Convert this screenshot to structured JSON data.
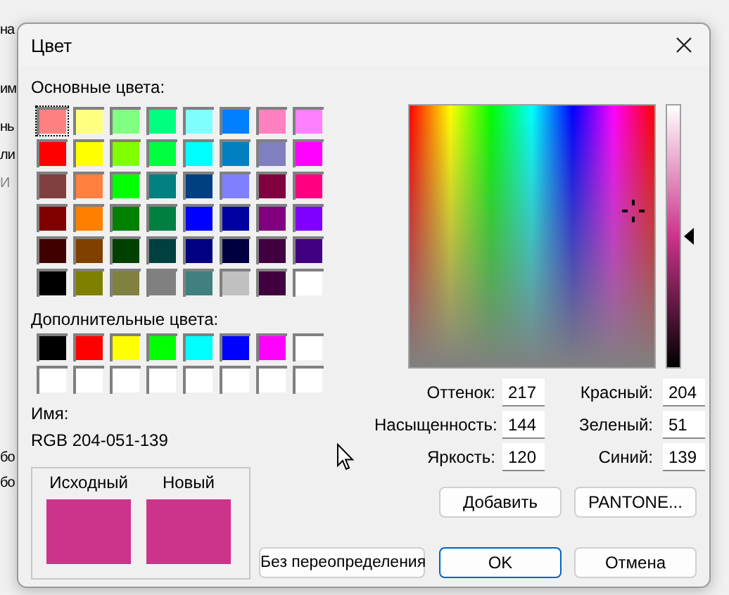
{
  "background_fragments": [
    "на",
    "им",
    "нь",
    "ли",
    "И",
    "бо",
    "бо"
  ],
  "window": {
    "title": "Цвет"
  },
  "basic_colors": {
    "label": "Основные цвета:",
    "swatches": [
      {
        "color": "#ff8080",
        "selected": true
      },
      {
        "color": "#ffff80",
        "selected": false
      },
      {
        "color": "#80ff80",
        "selected": false
      },
      {
        "color": "#00ff80",
        "selected": false
      },
      {
        "color": "#80ffff",
        "selected": false
      },
      {
        "color": "#0080ff",
        "selected": false
      },
      {
        "color": "#ff80c0",
        "selected": false
      },
      {
        "color": "#ff80ff",
        "selected": false
      },
      {
        "color": "#ff0000",
        "selected": false
      },
      {
        "color": "#ffff00",
        "selected": false
      },
      {
        "color": "#80ff00",
        "selected": false
      },
      {
        "color": "#00ff40",
        "selected": false
      },
      {
        "color": "#00ffff",
        "selected": false
      },
      {
        "color": "#0080c0",
        "selected": false
      },
      {
        "color": "#8080c0",
        "selected": false
      },
      {
        "color": "#ff00ff",
        "selected": false
      },
      {
        "color": "#804040",
        "selected": false
      },
      {
        "color": "#ff8040",
        "selected": false
      },
      {
        "color": "#00ff00",
        "selected": false
      },
      {
        "color": "#008080",
        "selected": false
      },
      {
        "color": "#004080",
        "selected": false
      },
      {
        "color": "#8080ff",
        "selected": false
      },
      {
        "color": "#800040",
        "selected": false
      },
      {
        "color": "#ff0080",
        "selected": false
      },
      {
        "color": "#800000",
        "selected": false
      },
      {
        "color": "#ff8000",
        "selected": false
      },
      {
        "color": "#008000",
        "selected": false
      },
      {
        "color": "#008040",
        "selected": false
      },
      {
        "color": "#0000ff",
        "selected": false
      },
      {
        "color": "#0000a0",
        "selected": false
      },
      {
        "color": "#800080",
        "selected": false
      },
      {
        "color": "#8000ff",
        "selected": false
      },
      {
        "color": "#400000",
        "selected": false
      },
      {
        "color": "#804000",
        "selected": false
      },
      {
        "color": "#004000",
        "selected": false
      },
      {
        "color": "#004040",
        "selected": false
      },
      {
        "color": "#000080",
        "selected": false
      },
      {
        "color": "#000040",
        "selected": false
      },
      {
        "color": "#400040",
        "selected": false
      },
      {
        "color": "#400080",
        "selected": false
      },
      {
        "color": "#000000",
        "selected": false
      },
      {
        "color": "#808000",
        "selected": false
      },
      {
        "color": "#808040",
        "selected": false
      },
      {
        "color": "#808080",
        "selected": false
      },
      {
        "color": "#408080",
        "selected": false
      },
      {
        "color": "#c0c0c0",
        "selected": false
      },
      {
        "color": "#400040",
        "selected": false
      },
      {
        "color": "#ffffff",
        "selected": false
      }
    ]
  },
  "custom_colors": {
    "label": "Дополнительные цвета:",
    "swatches": [
      {
        "color": "#000000",
        "selected": false
      },
      {
        "color": "#ff0000",
        "selected": false
      },
      {
        "color": "#ffff00",
        "selected": false
      },
      {
        "color": "#00ff00",
        "selected": false
      },
      {
        "color": "#00ffff",
        "selected": false
      },
      {
        "color": "#0000ff",
        "selected": false
      },
      {
        "color": "#ff00ff",
        "selected": false
      },
      {
        "color": "#ffffff",
        "selected": false
      },
      {
        "color": "#ffffff",
        "selected": false
      },
      {
        "color": "#ffffff",
        "selected": false
      },
      {
        "color": "#ffffff",
        "selected": false
      },
      {
        "color": "#ffffff",
        "selected": false
      },
      {
        "color": "#ffffff",
        "selected": false
      },
      {
        "color": "#ffffff",
        "selected": false
      },
      {
        "color": "#ffffff",
        "selected": false
      },
      {
        "color": "#ffffff",
        "selected": false
      }
    ]
  },
  "name": {
    "label": "Имя:",
    "value": "RGB 204-051-139"
  },
  "preview": [
    {
      "label": "Исходный",
      "color": "#cc338b"
    },
    {
      "label": "Новый",
      "color": "#cc338b"
    }
  ],
  "luminance_slider": {
    "level": 0.5
  },
  "fields": [
    {
      "label": "Оттенок:",
      "value": "217"
    },
    {
      "label": "Красный:",
      "value": "204"
    },
    {
      "label": "Насыщенность:",
      "value": "144"
    },
    {
      "label": "Зеленый:",
      "value": "51"
    },
    {
      "label": "Яркость:",
      "value": "120"
    },
    {
      "label": "Синий:",
      "value": "139"
    }
  ],
  "buttons": [
    {
      "label": "Добавить"
    },
    {
      "label": "PANTONE..."
    }
  ],
  "footer_buttons": [
    {
      "label": "Без переопределения",
      "default": false
    },
    {
      "label": "OK",
      "default": true
    },
    {
      "label": "Отмена",
      "default": false
    }
  ]
}
